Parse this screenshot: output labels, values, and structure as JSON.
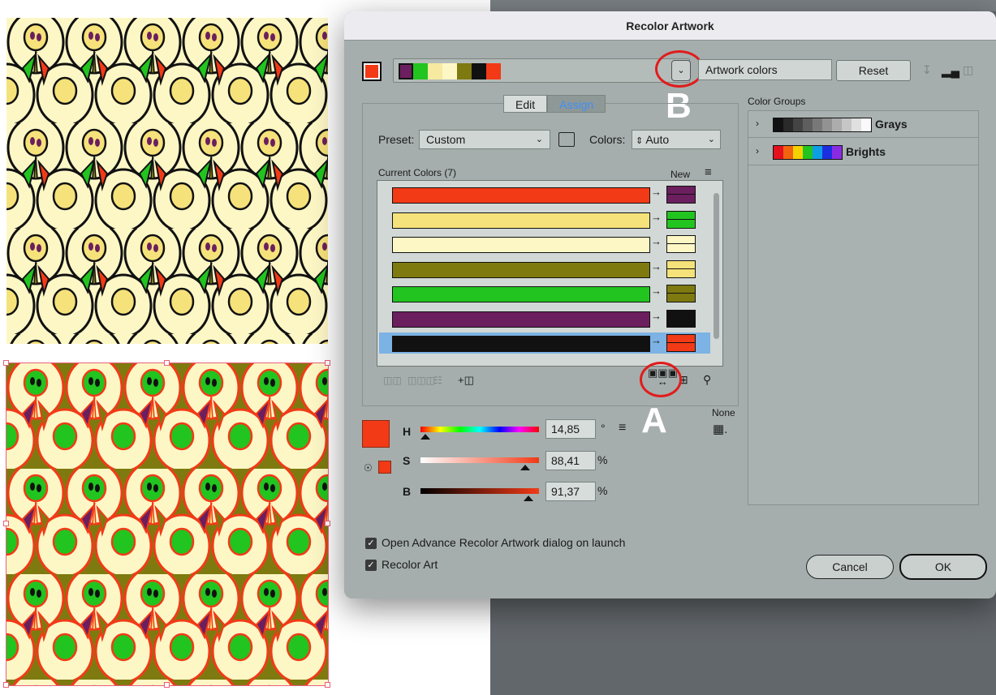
{
  "dialog": {
    "title": "Recolor Artwork",
    "active_color": "#f23a17",
    "harmony_strip": [
      "#6b1f5e",
      "#22c41f",
      "#f6eaa0",
      "#fdf7c6",
      "#7e7a10",
      "#111111",
      "#f23a17"
    ],
    "group_name": "Artwork colors",
    "reset_label": "Reset",
    "tabs": [
      "Edit",
      "Assign"
    ],
    "preset_label": "Preset:",
    "preset_value": "Custom",
    "colors_label": "Colors:",
    "colors_value": "Auto",
    "current_colors_label": "Current Colors (7)",
    "new_label": "New",
    "color_rows": [
      {
        "current": "#f23a17",
        "new": "#6b1f5e",
        "selected": false
      },
      {
        "current": "#f6e27a",
        "new": "#22c41f",
        "selected": false
      },
      {
        "current": "#fdf7c6",
        "new": "#fdf7c6",
        "selected": false
      },
      {
        "current": "#7e7a10",
        "new": "#f6e27a",
        "selected": false
      },
      {
        "current": "#22c41f",
        "new": "#7e7a10",
        "selected": false
      },
      {
        "current": "#6b1f5e",
        "new": "#111111",
        "selected": false
      },
      {
        "current": "#111111",
        "new": "#f23a17",
        "selected": true
      }
    ],
    "hsb": {
      "h_label": "H",
      "h_value": "14,85",
      "h_unit": "°",
      "s_label": "S",
      "s_value": "88,41",
      "s_unit": "%",
      "b_label": "B",
      "b_value": "91,37",
      "b_unit": "%",
      "h_fraction": 0.041,
      "s_fraction": 0.884,
      "b_fraction": 0.914
    },
    "none_label": "None",
    "annotations": {
      "a": "A",
      "b": "B"
    },
    "checkboxes": [
      {
        "label": "Open Advance Recolor Artwork dialog on launch",
        "checked": true
      },
      {
        "label": "Recolor Art",
        "checked": true
      }
    ],
    "cancel_label": "Cancel",
    "ok_label": "OK",
    "color_groups_label": "Color Groups",
    "color_groups": [
      {
        "name": "Grays",
        "swatches": [
          "#111111",
          "#2a2a2a",
          "#444444",
          "#5e5e5e",
          "#787878",
          "#929292",
          "#acacac",
          "#c6c6c6",
          "#e0e0e0",
          "#fafafa"
        ]
      },
      {
        "name": "Brights",
        "swatches": [
          "#e4101e",
          "#f2630f",
          "#f6d100",
          "#22c41f",
          "#0d9ee5",
          "#1c2fe0",
          "#8a2be2"
        ]
      }
    ]
  }
}
